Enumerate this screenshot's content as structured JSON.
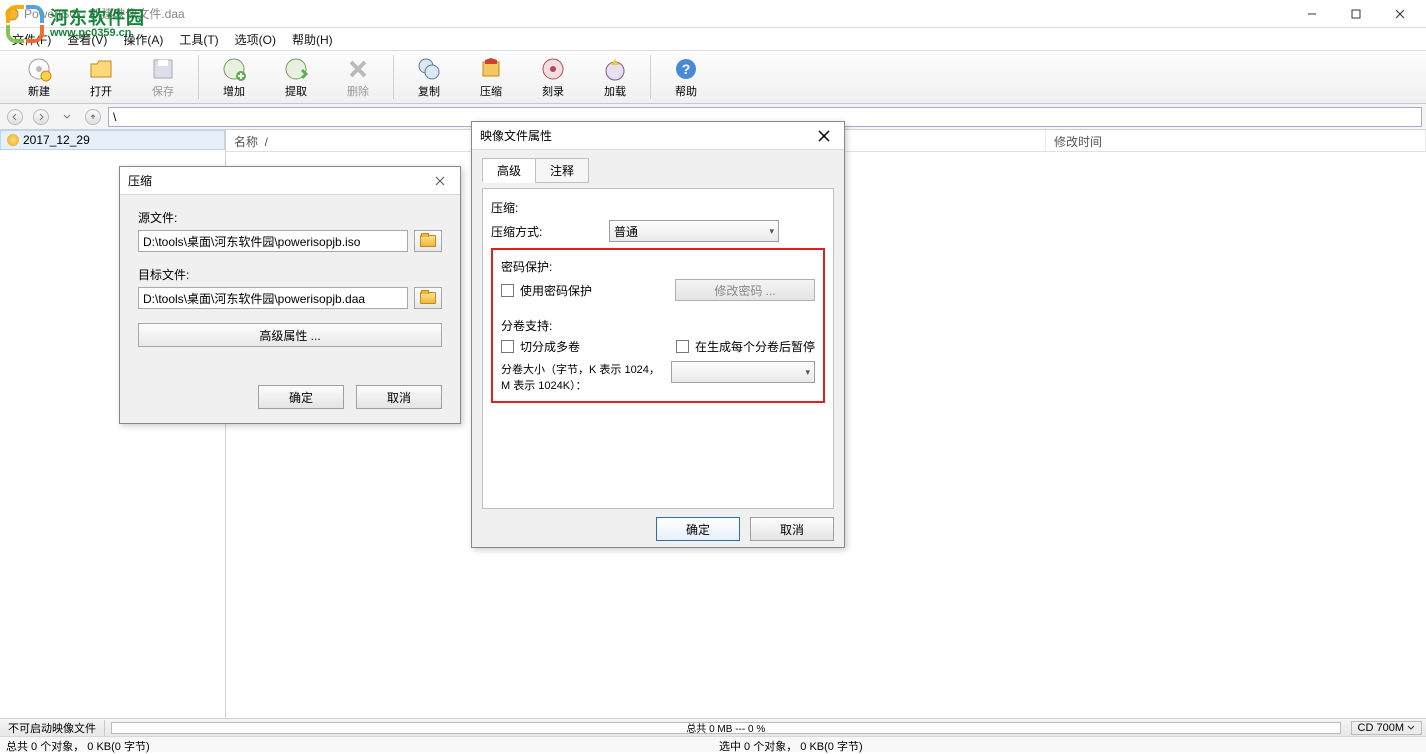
{
  "window": {
    "title": "PowerISO - 新建映像文件.daa"
  },
  "menu": {
    "file": "文件(F)",
    "view": "查看(V)",
    "action": "操作(A)",
    "tools": "工具(T)",
    "options": "选项(O)",
    "help": "帮助(H)"
  },
  "toolbar": {
    "new": "新建",
    "open": "打开",
    "save": "保存",
    "add": "增加",
    "extract": "提取",
    "delete": "删除",
    "copy": "复制",
    "compress": "压缩",
    "burn": "刻录",
    "mount": "加载",
    "help": "帮助"
  },
  "path": {
    "value": "\\"
  },
  "tree": {
    "root": "2017_12_29"
  },
  "listcols": {
    "name": "名称",
    "moddate": "修改时间"
  },
  "compress_dialog": {
    "title": "压缩",
    "source_label": "源文件:",
    "source_value": "D:\\tools\\桌面\\河东软件园\\powerisopjb.iso",
    "target_label": "目标文件:",
    "target_value": "D:\\tools\\桌面\\河东软件园\\powerisopjb.daa",
    "advanced": "高级属性 ...",
    "ok": "确定",
    "cancel": "取消"
  },
  "props_dialog": {
    "title": "映像文件属性",
    "tab_advanced": "高级",
    "tab_comment": "注释",
    "compress_section": "压缩:",
    "compress_mode_label": "压缩方式:",
    "compress_mode_value": "普通",
    "password_section": "密码保护:",
    "use_password": "使用密码保护",
    "change_password": "修改密码 ...",
    "split_section": "分卷支持:",
    "split_enable": "切分成多卷",
    "split_pause": "在生成每个分卷后暂停",
    "split_size_label": "分卷大小（字节，K 表示 1024，M 表示 1024K）：",
    "ok": "确定",
    "cancel": "取消"
  },
  "status": {
    "bootinfo": "不可启动映像文件",
    "progress": "总共  0 MB  ---  0 %",
    "media": "CD 700M",
    "left": "总共 0 个对象，  0 KB(0 字节)",
    "right": "选中 0 个对象，  0 KB(0 字节)"
  },
  "watermark": {
    "name": "河东软件园",
    "url": "www.pc0359.cn"
  }
}
